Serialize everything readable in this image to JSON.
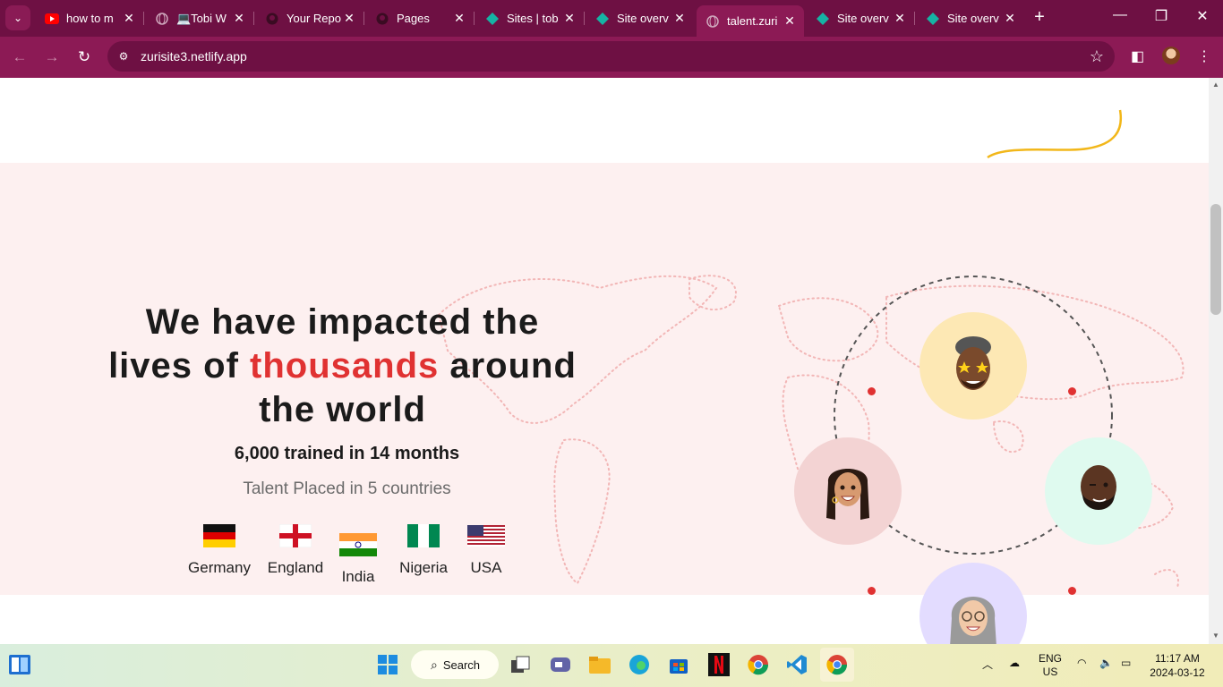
{
  "browser": {
    "tabs": [
      {
        "title": "how to m",
        "icon": "youtube-icon"
      },
      {
        "title": "💻Tobi W",
        "icon": "globe-icon"
      },
      {
        "title": "Your Repo",
        "icon": "github-icon"
      },
      {
        "title": "Pages",
        "icon": "github-icon"
      },
      {
        "title": "Sites | tob",
        "icon": "netlify-icon"
      },
      {
        "title": "Site overv",
        "icon": "netlify-icon"
      },
      {
        "title": "talent.zuri",
        "icon": "globe-icon",
        "active": true
      },
      {
        "title": "Site overv",
        "icon": "netlify-icon"
      },
      {
        "title": "Site overv",
        "icon": "netlify-icon"
      }
    ],
    "url": "zurisite3.netlify.app",
    "accent": "#8c1a55"
  },
  "page": {
    "headline_before": "We have impacted the lives of ",
    "headline_highlight": "thousands",
    "headline_after": " around the world",
    "trained": "6,000 trained in 14 months",
    "placed": "Talent Placed in 5 countries",
    "countries": [
      {
        "name": "Germany"
      },
      {
        "name": "England"
      },
      {
        "name": "India"
      },
      {
        "name": "Nigeria"
      },
      {
        "name": "USA"
      }
    ],
    "highlight_color": "#e03232"
  },
  "taskbar": {
    "search_label": "Search",
    "lang": "ENG",
    "region": "US",
    "time": "11:17 AM",
    "date": "2024-03-12"
  }
}
